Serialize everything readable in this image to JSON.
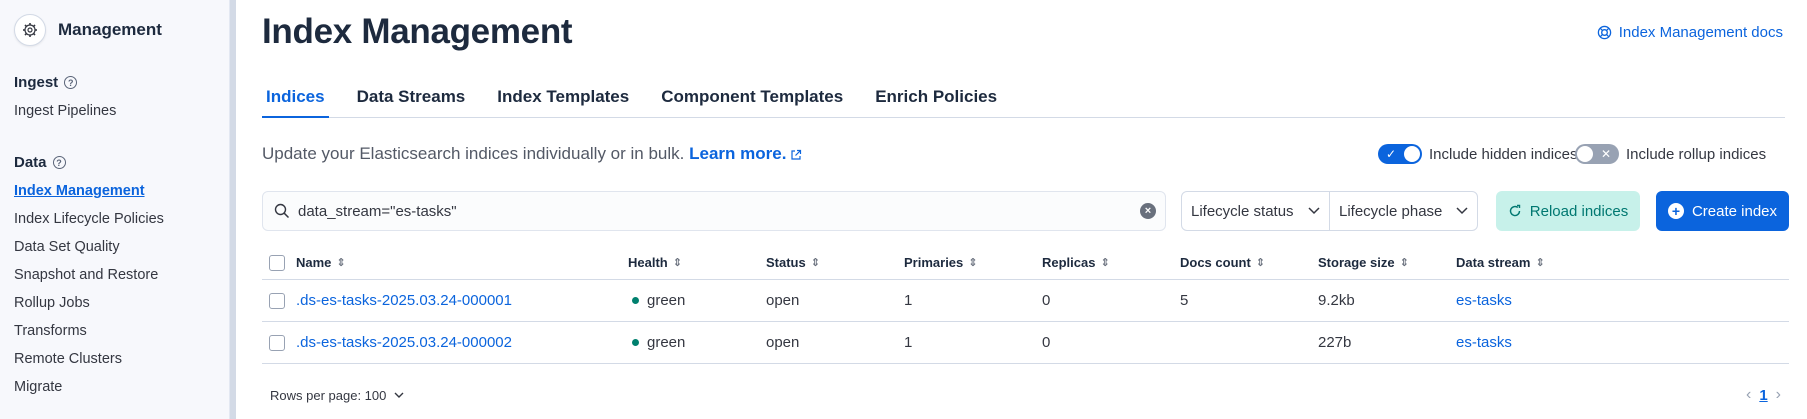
{
  "sidebar": {
    "title": "Management",
    "groups": {
      "ingest": {
        "label": "Ingest",
        "items": [
          "Ingest Pipelines"
        ]
      },
      "data": {
        "label": "Data",
        "items": [
          "Index Management",
          "Index Lifecycle Policies",
          "Data Set Quality",
          "Snapshot and Restore",
          "Rollup Jobs",
          "Transforms",
          "Remote Clusters",
          "Migrate"
        ]
      }
    },
    "active_item": "Index Management"
  },
  "page": {
    "title": "Index Management",
    "docs_link": "Index Management docs"
  },
  "tabs": [
    "Indices",
    "Data Streams",
    "Index Templates",
    "Component Templates",
    "Enrich Policies"
  ],
  "active_tab": "Indices",
  "description": {
    "text": "Update your Elasticsearch indices individually or in bulk.",
    "learn_more": "Learn more."
  },
  "toggles": {
    "hidden": {
      "label": "Include hidden indices",
      "on": true
    },
    "rollup": {
      "label": "Include rollup indices",
      "on": false
    }
  },
  "search": {
    "value": "data_stream=\"es-tasks\""
  },
  "filters": {
    "lifecycle_status": "Lifecycle status",
    "lifecycle_phase": "Lifecycle phase"
  },
  "buttons": {
    "reload": "Reload indices",
    "create": "Create index"
  },
  "table": {
    "columns": [
      "Name",
      "Health",
      "Status",
      "Primaries",
      "Replicas",
      "Docs count",
      "Storage size",
      "Data stream"
    ],
    "rows": [
      {
        "name": ".ds-es-tasks-2025.03.24-000001",
        "health": "green",
        "status": "open",
        "primaries": "1",
        "replicas": "0",
        "docs_count": "5",
        "storage_size": "9.2kb",
        "data_stream": "es-tasks"
      },
      {
        "name": ".ds-es-tasks-2025.03.24-000002",
        "health": "green",
        "status": "open",
        "primaries": "1",
        "replicas": "0",
        "docs_count": "",
        "storage_size": "227b",
        "data_stream": "es-tasks"
      }
    ]
  },
  "pagination": {
    "rows_per_page": "Rows per page: 100",
    "current_page": "1"
  },
  "colors": {
    "accent": "#0b64dd",
    "health_green": "#00806e",
    "reload_bg": "#c7f1ea"
  },
  "icons": {
    "logo": "gear-icon",
    "docs": "lifebuoy-icon",
    "search": "search-icon",
    "reload": "refresh-icon",
    "create": "plus-circle-icon"
  }
}
